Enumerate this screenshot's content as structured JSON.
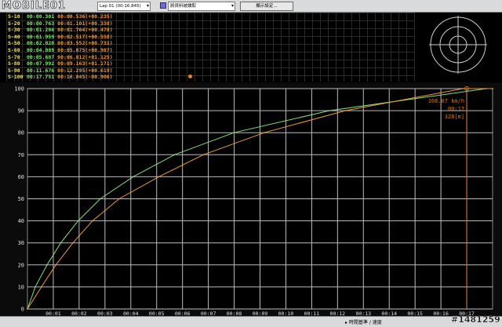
{
  "toolbar": {
    "logo": "MOBILE01",
    "lap_select": "Lap 01    (00:16.845)",
    "data_select": "將資料被讀取",
    "display_button": "顯示設定...",
    "dropdown_icon": "chevron-down-icon",
    "data_color": "#6a6ae8"
  },
  "sectors": [
    {
      "label": "S-10",
      "a": "00:00.301",
      "b": "00:00.536",
      "delta": "(+00.235)"
    },
    {
      "label": "S-20",
      "a": "00:00.763",
      "b": "00:01.101",
      "delta": "(+00.338)"
    },
    {
      "label": "S-30",
      "a": "00:01.286",
      "b": "00:01.764",
      "delta": "(+00.478)"
    },
    {
      "label": "S-40",
      "a": "00:01.959",
      "b": "00:02.517",
      "delta": "(+00.558)"
    },
    {
      "label": "S-50",
      "a": "00:02.820",
      "b": "00:03.552",
      "delta": "(+00.731)"
    },
    {
      "label": "S-60",
      "a": "00:04.089",
      "b": "00:05.075",
      "delta": "(+00.987)"
    },
    {
      "label": "S-70",
      "a": "00:05.687",
      "b": "00:06.812",
      "delta": "(+01.125)"
    },
    {
      "label": "S-80",
      "a": "00:07.992",
      "b": "00:09.163",
      "delta": "(+01.171)"
    },
    {
      "label": "S-90",
      "a": "00:11.676",
      "b": "00:12.295",
      "delta": "(+00.619)"
    },
    {
      "label": "S-100",
      "a": "00:17.751",
      "b": "00:16.845",
      "delta": "(-00.906)"
    }
  ],
  "cursor": {
    "speed": "108.07 km/h",
    "time": "00:17",
    "distance": "328[m]"
  },
  "bottom": {
    "axis_mode": "▸ 時間基準 / 速度"
  },
  "watermark": "#1481259",
  "colors": {
    "series_a": "#86e07a",
    "series_b": "#f09a3a",
    "cursor": "#d8782a",
    "label": "#f2e27a",
    "grid": "#bdbdbd"
  },
  "chart_data": {
    "type": "line",
    "xlabel": "",
    "ylabel": "",
    "xlim": [
      0,
      18
    ],
    "ylim": [
      0,
      100
    ],
    "x_ticks": [
      "00:01",
      "00:02",
      "00:03",
      "00:04",
      "00:05",
      "00:06",
      "00:07",
      "00:08",
      "00:09",
      "00:10",
      "00:11",
      "00:12",
      "00:13",
      "00:14",
      "00:15",
      "00:16",
      "00:17"
    ],
    "y_ticks": [
      "0",
      "10",
      "20",
      "30",
      "40",
      "50",
      "60",
      "70",
      "80",
      "90",
      "100"
    ],
    "cursor_x": 17.0,
    "series": [
      {
        "color": "#86e07a",
        "x": [
          0.0,
          0.3,
          0.76,
          1.29,
          1.96,
          2.82,
          4.09,
          5.69,
          7.99,
          11.68,
          17.75,
          18.0
        ],
        "y": [
          0,
          10,
          20,
          30,
          40,
          50,
          60,
          70,
          80,
          90,
          100,
          100
        ]
      },
      {
        "color": "#f09a3a",
        "x": [
          0.0,
          0.54,
          1.1,
          1.76,
          2.52,
          3.55,
          5.08,
          6.81,
          9.16,
          12.3,
          16.85,
          18.0
        ],
        "y": [
          0,
          10,
          20,
          30,
          40,
          50,
          60,
          70,
          80,
          90,
          100,
          100
        ]
      }
    ]
  }
}
